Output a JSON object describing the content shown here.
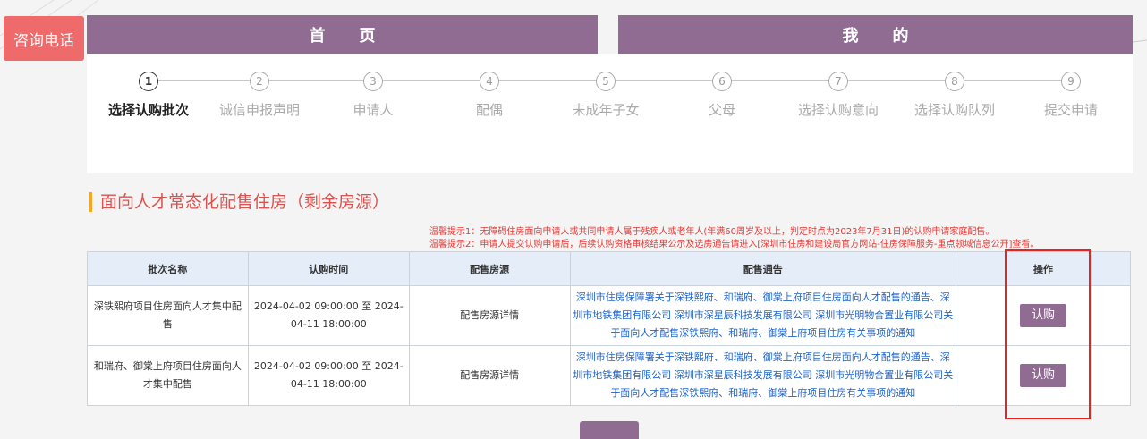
{
  "hotline": {
    "label": "咨询电话"
  },
  "nav": {
    "home": "首页",
    "mine": "我的"
  },
  "steps": [
    {
      "num": "1",
      "label": "选择认购批次",
      "active": true
    },
    {
      "num": "2",
      "label": "诚信申报声明",
      "active": false
    },
    {
      "num": "3",
      "label": "申请人",
      "active": false
    },
    {
      "num": "4",
      "label": "配偶",
      "active": false
    },
    {
      "num": "5",
      "label": "未成年子女",
      "active": false
    },
    {
      "num": "6",
      "label": "父母",
      "active": false
    },
    {
      "num": "7",
      "label": "选择认购意向",
      "active": false
    },
    {
      "num": "8",
      "label": "选择认购队列",
      "active": false
    },
    {
      "num": "9",
      "label": "提交申请",
      "active": false
    }
  ],
  "section": {
    "title": "面向人才常态化配售住房（剩余房源）"
  },
  "tips": [
    "温馨提示1：无障碍住房面向申请人或共同申请人属于残疾人或老年人(年满60周岁及以上，判定时点为2023年7月31日)的认购申请家庭配售。",
    "温馨提示2：申请人提交认购申请后，后续认购资格审核结果公示及选房通告请进入[深圳市住房和建设局官方网站-住房保障服务-重点领域信息公开]查看。"
  ],
  "table": {
    "headers": [
      "批次名称",
      "认购时间",
      "配售房源",
      "配售通告",
      "操作"
    ],
    "rows": [
      {
        "name": "深铁熙府项目住房面向人才集中配售",
        "time": "2024-04-02 09:00:00 至 2024-04-11 18:00:00",
        "source": "配售房源详情",
        "notice": "深圳市住房保障署关于深铁熙府、和瑞府、御棠上府项目住房面向人才配售的通告、深圳市地铁集团有限公司 深圳市深星辰科技发展有限公司 深圳市光明物合置业有限公司关于面向人才配售深铁熙府、和瑞府、御棠上府项目住房有关事项的通知",
        "action": "认购"
      },
      {
        "name": "和瑞府、御棠上府项目住房面向人才集中配售",
        "time": "2024-04-02 09:00:00 至 2024-04-11 18:00:00",
        "source": "配售房源详情",
        "notice": "深圳市住房保障署关于深铁熙府、和瑞府、御棠上府项目住房面向人才配售的通告、深圳市地铁集团有限公司 深圳市深星辰科技发展有限公司 深圳市光明物合置业有限公司关于面向人才配售深铁熙府、和瑞府、御棠上府项目住房有关事项的通知",
        "action": "认购"
      }
    ]
  },
  "colors": {
    "primary": "#906c93",
    "hotline": "#ef6b6b",
    "tip": "#e53935",
    "link": "#1e63c8",
    "highlight": "#e8231e",
    "title_bar": "#f5a623"
  }
}
